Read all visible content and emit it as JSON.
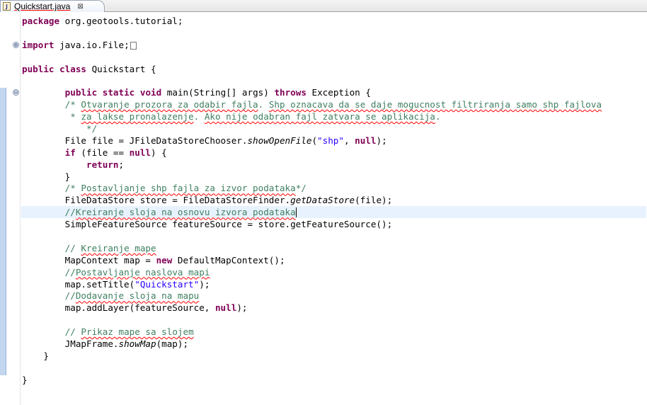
{
  "tab": {
    "file_icon_letter": "J",
    "title": "Quickstart.java",
    "close_glyph": "⊠"
  },
  "editor": {
    "fold_expand_glyph": "⊕",
    "fold_collapse_glyph": "⊖",
    "lines": [
      [
        {
          "t": "kw",
          "v": "package"
        },
        {
          "t": "",
          "v": " org.geotools.tutorial;"
        }
      ],
      [],
      [
        {
          "t": "kw",
          "v": "import"
        },
        {
          "t": "",
          "v": " java.io.File;"
        },
        {
          "t": "elided",
          "v": ""
        }
      ],
      [],
      [
        {
          "t": "kw",
          "v": "public"
        },
        {
          "t": "",
          "v": " "
        },
        {
          "t": "kw",
          "v": "class"
        },
        {
          "t": "",
          "v": " Quickstart {"
        }
      ],
      [],
      [
        {
          "t": "",
          "v": "        "
        },
        {
          "t": "kw",
          "v": "public"
        },
        {
          "t": "",
          "v": " "
        },
        {
          "t": "kw",
          "v": "static"
        },
        {
          "t": "",
          "v": " "
        },
        {
          "t": "kw",
          "v": "void"
        },
        {
          "t": "",
          "v": " main(String[] args) "
        },
        {
          "t": "kw",
          "v": "throws"
        },
        {
          "t": "",
          "v": " Exception {"
        }
      ],
      [
        {
          "t": "",
          "v": "        "
        },
        {
          "t": "cm",
          "v": "/* "
        },
        {
          "t": "cm sq",
          "v": "Otvaranje prozora za odabir fajla"
        },
        {
          "t": "cm",
          "v": ". "
        },
        {
          "t": "cm sq",
          "v": "Shp oznacava da se daje mogucnost filtriranja samo shp fajlova"
        }
      ],
      [
        {
          "t": "",
          "v": "         "
        },
        {
          "t": "cm",
          "v": "* "
        },
        {
          "t": "cm sq",
          "v": "za lakse pronalazenje"
        },
        {
          "t": "cm",
          "v": ". "
        },
        {
          "t": "cm sq",
          "v": "Ako nije odabran fajl zatvara se aplikacija"
        },
        {
          "t": "cm",
          "v": "."
        }
      ],
      [
        {
          "t": "",
          "v": "            "
        },
        {
          "t": "cm",
          "v": "*/"
        }
      ],
      [
        {
          "t": "",
          "v": "        File file = JFileDataStoreChooser."
        },
        {
          "t": "it",
          "v": "showOpenFile"
        },
        {
          "t": "",
          "v": "("
        },
        {
          "t": "str",
          "v": "\"shp\""
        },
        {
          "t": "",
          "v": ", "
        },
        {
          "t": "kw",
          "v": "null"
        },
        {
          "t": "",
          "v": ");"
        }
      ],
      [
        {
          "t": "",
          "v": "        "
        },
        {
          "t": "kw",
          "v": "if"
        },
        {
          "t": "",
          "v": " (file == "
        },
        {
          "t": "kw",
          "v": "null"
        },
        {
          "t": "",
          "v": ") {"
        }
      ],
      [
        {
          "t": "",
          "v": "            "
        },
        {
          "t": "kw",
          "v": "return"
        },
        {
          "t": "",
          "v": ";"
        }
      ],
      [
        {
          "t": "",
          "v": "        }"
        }
      ],
      [
        {
          "t": "",
          "v": "        "
        },
        {
          "t": "cm",
          "v": "/* "
        },
        {
          "t": "cm sq",
          "v": "Postavljanje shp fajla za izvor podataka"
        },
        {
          "t": "cm",
          "v": "*/"
        }
      ],
      [
        {
          "t": "",
          "v": "        FileDataStore store = FileDataStoreFinder."
        },
        {
          "t": "it",
          "v": "getDataStore"
        },
        {
          "t": "",
          "v": "(file);"
        }
      ],
      [
        {
          "t": "",
          "v": "        "
        },
        {
          "t": "cm",
          "v": "//"
        },
        {
          "t": "cm sq",
          "v": "Kreiranje sloja na osnovu izvora podataka"
        },
        {
          "t": "caret",
          "v": ""
        }
      ],
      [
        {
          "t": "",
          "v": "        SimpleFeatureSource featureSource = store.getFeatureSource();"
        }
      ],
      [],
      [
        {
          "t": "",
          "v": "        "
        },
        {
          "t": "cm",
          "v": "// "
        },
        {
          "t": "cm sq",
          "v": "Kreiranje mape"
        }
      ],
      [
        {
          "t": "",
          "v": "        MapContext map = "
        },
        {
          "t": "kw",
          "v": "new"
        },
        {
          "t": "",
          "v": " DefaultMapContext();"
        }
      ],
      [
        {
          "t": "",
          "v": "        "
        },
        {
          "t": "cm",
          "v": "//"
        },
        {
          "t": "cm sq",
          "v": "Postavljanje naslova mapi"
        }
      ],
      [
        {
          "t": "",
          "v": "        map.setTitle("
        },
        {
          "t": "str",
          "v": "\"Quickstart\""
        },
        {
          "t": "",
          "v": ");"
        }
      ],
      [
        {
          "t": "",
          "v": "        "
        },
        {
          "t": "cm",
          "v": "//"
        },
        {
          "t": "cm sq",
          "v": "Dodavanje sloja na mapu"
        }
      ],
      [
        {
          "t": "",
          "v": "        map.addLayer(featureSource, "
        },
        {
          "t": "kw",
          "v": "null"
        },
        {
          "t": "",
          "v": ");"
        }
      ],
      [],
      [
        {
          "t": "",
          "v": "        "
        },
        {
          "t": "cm",
          "v": "// "
        },
        {
          "t": "cm sq",
          "v": "Prikaz mape sa slojem"
        }
      ],
      [
        {
          "t": "",
          "v": "        JMapFrame."
        },
        {
          "t": "it",
          "v": "showMap"
        },
        {
          "t": "",
          "v": "(map);"
        }
      ],
      [
        {
          "t": "",
          "v": "    }"
        }
      ],
      [],
      [
        {
          "t": "",
          "v": "}"
        }
      ]
    ],
    "current_line_index": 16,
    "colors": {
      "keyword": "#7f0055",
      "comment": "#3f7f5f",
      "string": "#2a00ff",
      "current_line": "#e8f2fe",
      "change_bar": "#c3d6ef"
    }
  }
}
